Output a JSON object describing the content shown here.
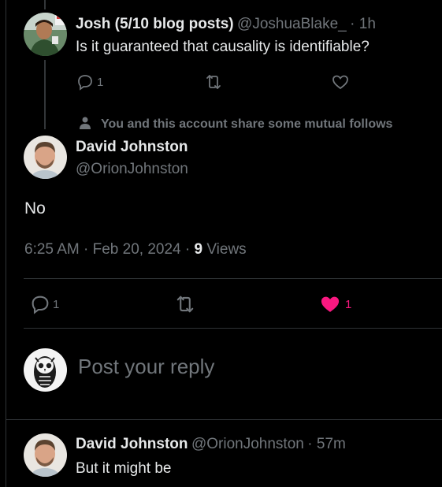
{
  "parent_tweet": {
    "name": "Josh (5/10 blog posts)",
    "handle": "@JoshuaBlake_",
    "time": "· 1h",
    "text": "Is it guaranteed that causality is identifiable?",
    "replies": "1",
    "icons": [
      "reply-icon",
      "retweet-icon",
      "like-icon"
    ]
  },
  "focus_tweet": {
    "social_context": "You and this account share some mutual follows",
    "name": "David Johnston",
    "handle": "@OrionJohnston",
    "text": "No",
    "time": "6:25 AM",
    "date": "Feb 20, 2024",
    "views_count": "9",
    "views_label": "Views",
    "separator": "·",
    "replies": "1",
    "likes": "1",
    "liked": true,
    "like_color": "#f91880"
  },
  "reply_box": {
    "placeholder": "Post your reply"
  },
  "reply_tweet": {
    "name": "David Johnston",
    "handle": "@OrionJohnston",
    "time": "· 57m",
    "text": "But it might be"
  },
  "colors": {
    "background": "#000000",
    "text_primary": "#e7e9ea",
    "text_secondary": "#71767b",
    "divider": "#2f3336"
  }
}
